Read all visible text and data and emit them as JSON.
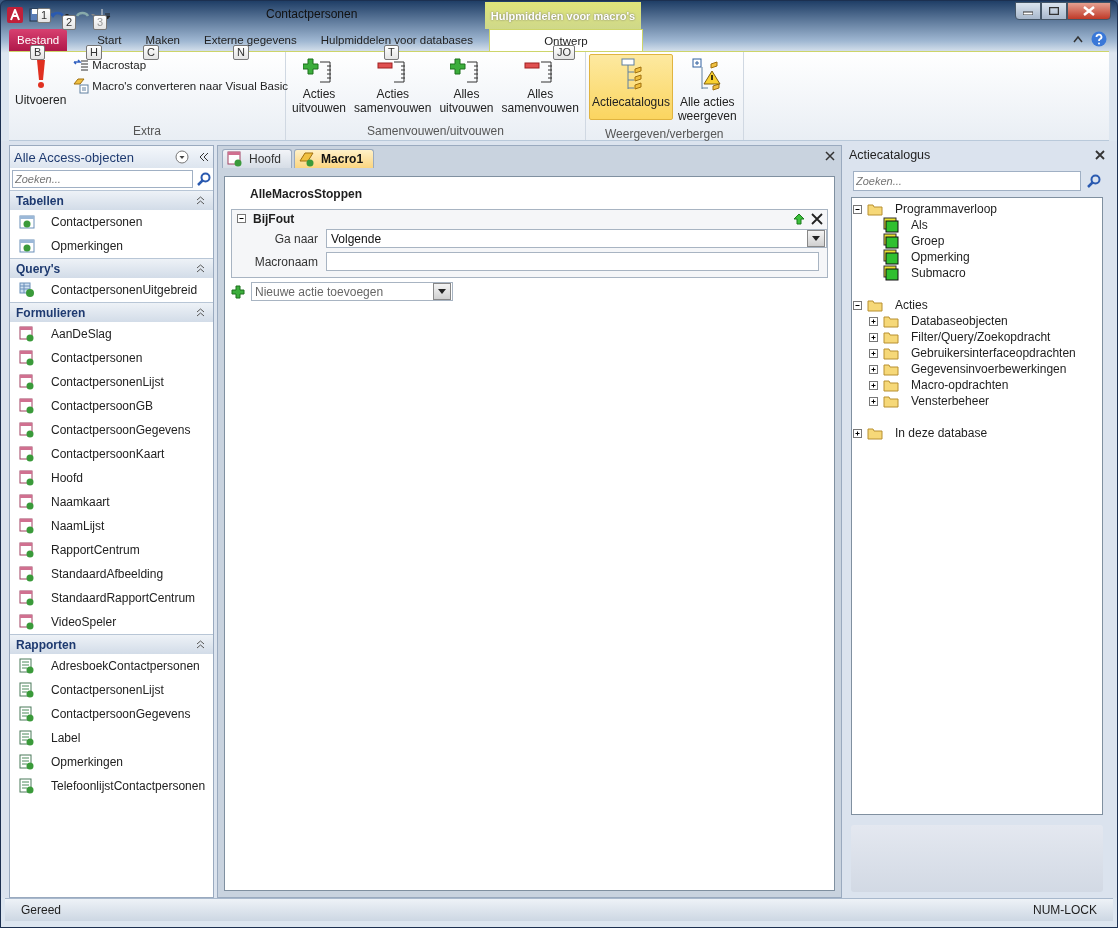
{
  "window": {
    "title": "Contactpersonen",
    "quick_access_keytips": [
      "1",
      "2",
      "3"
    ]
  },
  "context_tab": "Hulpmiddelen voor macro's",
  "tabs": [
    {
      "label": "Bestand",
      "kind": "file",
      "selected": false,
      "keytip": "B"
    },
    {
      "label": "Start",
      "kind": "tab",
      "selected": false,
      "keytip": "H"
    },
    {
      "label": "Maken",
      "kind": "tab",
      "selected": false,
      "keytip": "C"
    },
    {
      "label": "Externe gegevens",
      "kind": "tab",
      "selected": false,
      "keytip": "N"
    },
    {
      "label": "Hulpmiddelen voor databases",
      "kind": "tab",
      "selected": false,
      "keytip": "T"
    },
    {
      "label": "Ontwerp",
      "kind": "contextual",
      "selected": true,
      "keytip": "JO"
    }
  ],
  "ribbon": [
    {
      "name": "Extra",
      "buttons": [
        {
          "kind": "run",
          "lines": [
            "Uitvoeren"
          ],
          "selected": false
        },
        {
          "kind": "step",
          "lines": [
            "Macrostap"
          ],
          "selected": false
        },
        {
          "kind": "convert",
          "lines": [
            "Macro's converteren naar Visual Basic"
          ],
          "selected": false
        }
      ]
    },
    {
      "name": "Samenvouwen/uitvouwen",
      "buttons": [
        {
          "kind": "expand",
          "lines": [
            "Acties",
            "uitvouwen"
          ],
          "selected": false
        },
        {
          "kind": "collapse",
          "lines": [
            "Acties",
            "samenvouwen"
          ],
          "selected": false
        },
        {
          "kind": "expand",
          "lines": [
            "Alles",
            "uitvouwen"
          ],
          "selected": false
        },
        {
          "kind": "collapse",
          "lines": [
            "Alles",
            "samenvouwen"
          ],
          "selected": false
        }
      ]
    },
    {
      "name": "Weergeven/verbergen",
      "buttons": [
        {
          "kind": "catalog",
          "lines": [
            "Actiecatalogus"
          ],
          "selected": true
        },
        {
          "kind": "showall",
          "lines": [
            "Alle acties",
            "weergeven"
          ],
          "selected": false
        }
      ]
    }
  ],
  "nav": {
    "title": "Alle Access-objecten",
    "search_placeholder": "Zoeken...",
    "groups": [
      {
        "name": "Tabellen",
        "kind": "table",
        "items": [
          "Contactpersonen",
          "Opmerkingen"
        ]
      },
      {
        "name": "Query's",
        "kind": "query",
        "items": [
          "ContactpersonenUitgebreid"
        ]
      },
      {
        "name": "Formulieren",
        "kind": "form",
        "items": [
          "AanDeSlag",
          "Contactpersonen",
          "ContactpersonenLijst",
          "ContactpersoonGB",
          "ContactpersoonGegevens",
          "ContactpersoonKaart",
          "Hoofd",
          "Naamkaart",
          "NaamLijst",
          "RapportCentrum",
          "StandaardAfbeelding",
          "StandaardRapportCentrum",
          "VideoSpeler"
        ]
      },
      {
        "name": "Rapporten",
        "kind": "report",
        "items": [
          "AdresboekContactpersonen",
          "ContactpersonenLijst",
          "ContactpersoonGegevens",
          "Label",
          "Opmerkingen",
          "TelefoonlijstContactpersonen"
        ]
      }
    ]
  },
  "doc_tabs": [
    {
      "label": "Hoofd",
      "kind": "form",
      "selected": false
    },
    {
      "label": "Macro1",
      "kind": "macro",
      "selected": true
    }
  ],
  "macro": {
    "first_action": "AlleMacrosStoppen",
    "block": {
      "title": "BijFout",
      "expanded": true,
      "fields": [
        {
          "label": "Ga naar",
          "value": "Volgende",
          "kind": "dropdown"
        },
        {
          "label": "Macronaam",
          "kind": "text"
        }
      ]
    },
    "add_placeholder": "Nieuwe actie toevoegen"
  },
  "catalog": {
    "title": "Actiecatalogus",
    "search_placeholder": "Zoeken...",
    "tree": [
      {
        "label": "Programmaverloop",
        "kind": "folder",
        "expanded": true,
        "children": [
          {
            "label": "Als",
            "kind": "action"
          },
          {
            "label": "Groep",
            "kind": "action"
          },
          {
            "label": "Opmerking",
            "kind": "action"
          },
          {
            "label": "Submacro",
            "kind": "action"
          }
        ]
      },
      {
        "label": "Acties",
        "kind": "folder",
        "expanded": true,
        "children": [
          {
            "label": "Databaseobjecten",
            "kind": "folder",
            "expanded": false
          },
          {
            "label": "Filter/Query/Zoekopdracht",
            "kind": "folder",
            "expanded": false
          },
          {
            "label": "Gebruikersinterfaceopdrachten",
            "kind": "folder",
            "expanded": false
          },
          {
            "label": "Gegevensinvoerbewerkingen",
            "kind": "folder",
            "expanded": false
          },
          {
            "label": "Macro-opdrachten",
            "kind": "folder",
            "expanded": false
          },
          {
            "label": "Vensterbeheer",
            "kind": "folder",
            "expanded": false
          }
        ]
      },
      {
        "label": "In deze database",
        "kind": "folder",
        "expanded": false
      }
    ]
  },
  "status_bar": {
    "left": "Gereed",
    "right": "NUM-LOCK"
  }
}
